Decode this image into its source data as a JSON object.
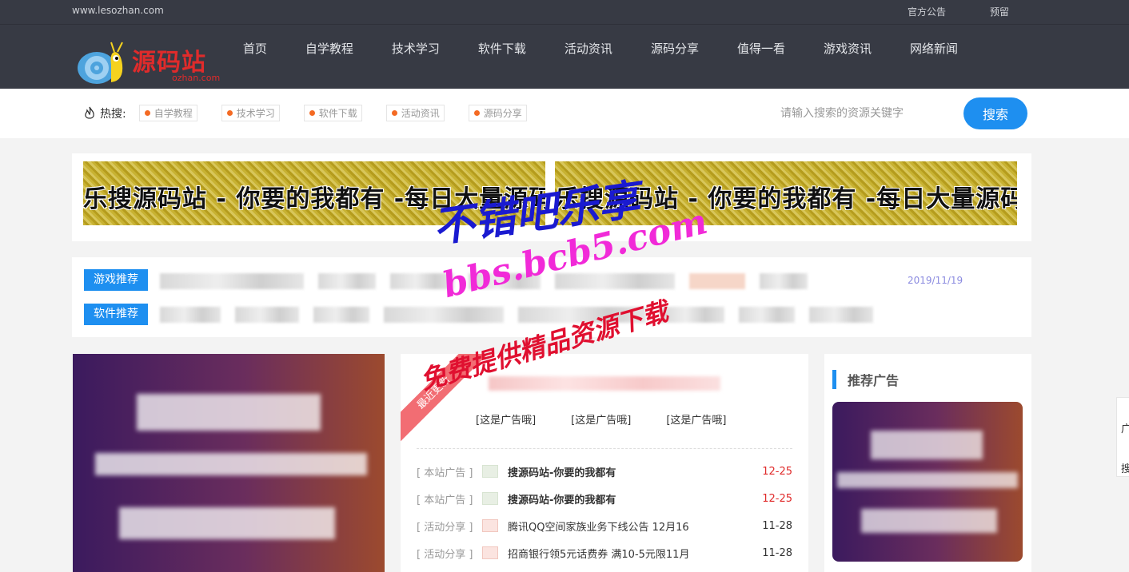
{
  "topbar": {
    "url": "www.lesozhan.com",
    "links": [
      "官方公告",
      "预留"
    ]
  },
  "header": {
    "brand": "源码站",
    "brand_sub": "ozhan.com",
    "nav": [
      "首页",
      "自学教程",
      "技术学习",
      "软件下载",
      "活动资讯",
      "源码分享",
      "值得一看",
      "游戏资讯",
      "网络新闻"
    ]
  },
  "search": {
    "hot_label": "热搜:",
    "tags": [
      "自学教程",
      "技术学习",
      "软件下载",
      "活动资讯",
      "源码分享"
    ],
    "placeholder": "请输入搜索的资源关键字",
    "button": "搜索"
  },
  "banners": [
    "乐搜源码站 - 你要的我都有 -每日大量源码/教程/活动",
    "乐搜源码站 - 你要的我都有 -每日大量源码/教程/活动"
  ],
  "recommend": {
    "game_label": "游戏推荐",
    "software_label": "软件推荐",
    "date": "2019/11/19"
  },
  "middle": {
    "ribbon": "最近更新",
    "ad_links": [
      "[这是广告哦]",
      "[这是广告哦]",
      "[这是广告哦]"
    ],
    "news": [
      {
        "cat": "[ 本站广告 ]",
        "title": "搜源码站-你要的我都有",
        "date": "12-25",
        "hot": true
      },
      {
        "cat": "[ 本站广告 ]",
        "title": "搜源码站-你要的我都有",
        "date": "12-25",
        "hot": true
      },
      {
        "cat": "[ 活动分享 ]",
        "title": "腾讯QQ空间家族业务下线公告 12月16",
        "date": "11-28",
        "hot": false
      },
      {
        "cat": "[ 活动分享 ]",
        "title": "招商银行领5元话费券 满10-5元限11月",
        "date": "11-28",
        "hot": false
      }
    ]
  },
  "right": {
    "title": "推荐广告"
  },
  "sidefloat": {
    "items": [
      "广",
      "搜"
    ]
  },
  "watermark": {
    "line1": "不错吧乐享",
    "line2": "bbs.bcb5.com",
    "line3": "免费提供精品资源下载"
  },
  "colors": {
    "topbar_bg": "#373a44",
    "accent": "#1e8ff0",
    "hot_dot": "#f46a23",
    "date_red": "#e02b2b"
  }
}
